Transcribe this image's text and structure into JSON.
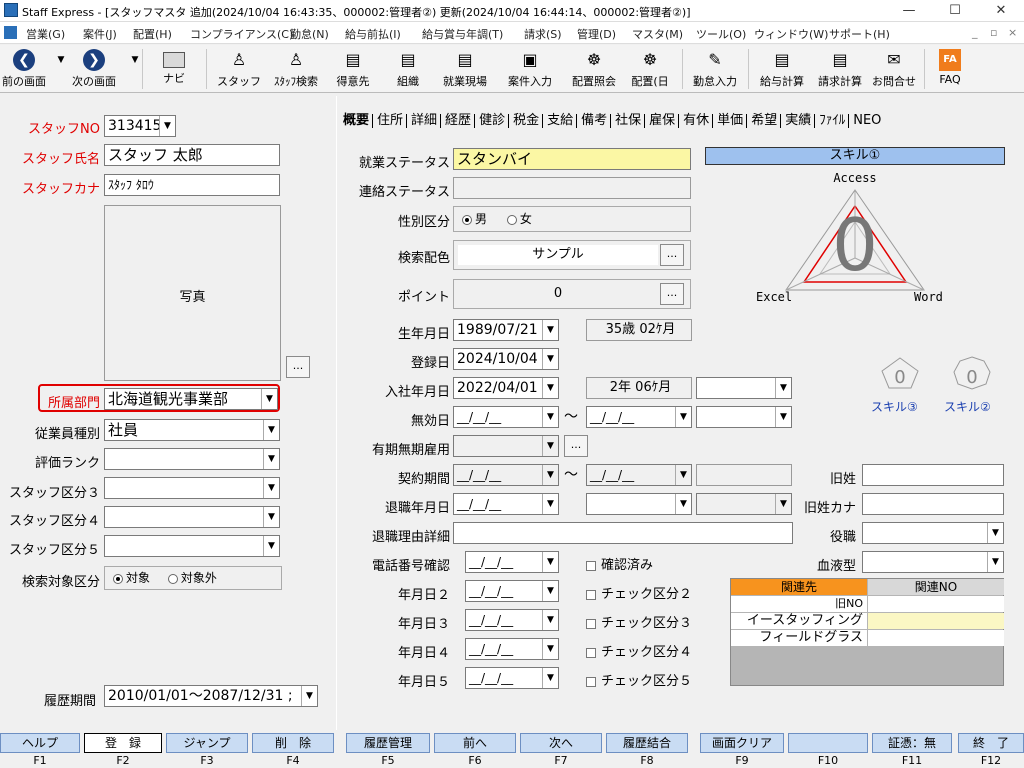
{
  "titlebar": {
    "title": "Staff Express - [スタッフマスタ 追加(2024/10/04 16:43:35、000002:管理者②) 更新(2024/10/04 16:44:14、000002:管理者②)]"
  },
  "menu": [
    "営業(G)",
    "案件(J)",
    "配置(H)",
    "コンプライアンス(C)",
    "勤怠(N)",
    "給与前払(I)",
    "給与賞与年調(T)",
    "請求(S)",
    "管理(D)",
    "マスタ(M)",
    "ツール(O)",
    "ウィンドウ(W)",
    "サポート(H)"
  ],
  "toolbar": [
    "前の画面",
    "次の画面",
    "ナビ",
    "スタッフ",
    "ｽﾀｯﾌ検索",
    "得意先",
    "組織",
    "就業現場",
    "案件入力",
    "配置照会",
    "配置(日",
    "勤怠入力",
    "給与計算",
    "請求計算",
    "お問合せ",
    "FAQ"
  ],
  "left": {
    "staff_no_label": "スタッフNO",
    "staff_no": "313415",
    "name_label": "スタッフ氏名",
    "name": "スタッフ 太郎",
    "kana_label": "スタッフカナ",
    "kana": "ｽﾀｯﾌ ﾀﾛｳ",
    "photo_label": "写真",
    "photo_btn": "...",
    "dept_label": "所属部門",
    "dept": "北海道観光事業部",
    "emp_type_label": "従業員種別",
    "emp_type": "社員",
    "rank_label": "評価ランク",
    "cat3_label": "スタッフ区分３",
    "cat4_label": "スタッフ区分４",
    "cat5_label": "スタッフ区分５",
    "search_label": "検索対象区分",
    "search_on": "対象",
    "search_off": "対象外",
    "history_label": "履歴期間",
    "history": "2010/01/01～2087/12/31 ;"
  },
  "tabs": [
    "概要",
    "住所",
    "詳細",
    "経歴",
    "健診",
    "税金",
    "支給",
    "備考",
    "社保",
    "雇保",
    "有休",
    "単価",
    "希望",
    "実績",
    "ﾌｧｲﾙ",
    "NEO"
  ],
  "main": {
    "work_status_label": "就業ステータス",
    "work_status": "スタンバイ",
    "contact_status_label": "連絡ステータス",
    "gender_label": "性別区分",
    "male": "男",
    "female": "女",
    "color_label": "検索配色",
    "color_value": "サンプル",
    "point_label": "ポイント",
    "point_value": "0",
    "birth_label": "生年月日",
    "birth": "1989/07/21",
    "age": "35歳 02ｹ月",
    "reg_label": "登録日",
    "reg": "2024/10/04",
    "join_label": "入社年月日",
    "join": "2022/04/01",
    "tenure": "2年 06ｹ月",
    "invalid_label": "無効日",
    "blank_date": "__/__/__",
    "contract_type_label": "有期無期雇用",
    "contract_period_label": "契約期間",
    "retire_label": "退職年月日",
    "retire_reason_label": "退職理由詳細",
    "phone_check_label": "電話番号確認",
    "confirmed": "確認済み",
    "date2_label": "年月日２",
    "date3_label": "年月日３",
    "date4_label": "年月日４",
    "date5_label": "年月日５",
    "check2": "チェック区分２",
    "check3": "チェック区分３",
    "check4": "チェック区分４",
    "check5": "チェック区分５",
    "tilde": "～",
    "old_name_label": "旧姓",
    "old_kana_label": "旧姓カナ",
    "position_label": "役職",
    "blood_label": "血液型",
    "rel_head1": "関連先",
    "rel_head2": "関連NO",
    "rel_rows": [
      "旧NO",
      "イースタッフィング",
      "フィールドグラス"
    ]
  },
  "skills": {
    "title": "スキル①",
    "top": "Access",
    "left": "Excel",
    "right": "Word",
    "value": "0",
    "small3": "スキル③",
    "small2": "スキル②"
  },
  "fkeys": [
    {
      "label": "ヘルプ",
      "key": "F1"
    },
    {
      "label": "登　録",
      "key": "F2"
    },
    {
      "label": "ジャンプ",
      "key": "F3"
    },
    {
      "label": "削　除",
      "key": "F4"
    },
    {
      "label": "履歴管理",
      "key": "F5"
    },
    {
      "label": "前へ",
      "key": "F6"
    },
    {
      "label": "次へ",
      "key": "F7"
    },
    {
      "label": "履歴結合",
      "key": "F8"
    },
    {
      "label": "画面クリア",
      "key": "F9"
    },
    {
      "label": "",
      "key": "F10"
    },
    {
      "label": "証憑：無",
      "key": "F11"
    },
    {
      "label": "終　了",
      "key": "F12"
    }
  ]
}
